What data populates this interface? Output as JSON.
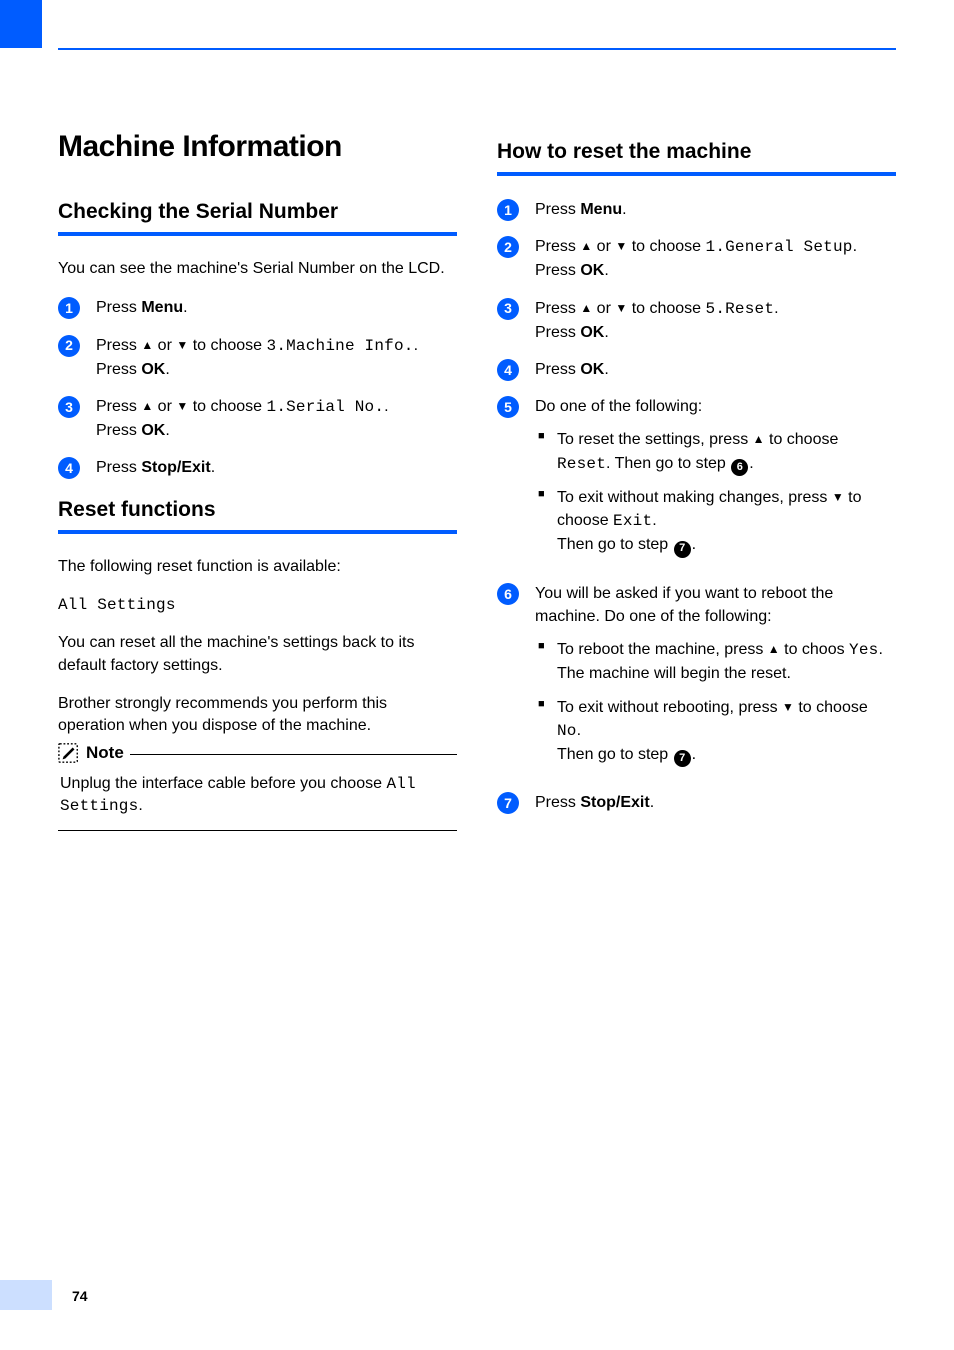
{
  "pageNumber": "74",
  "left": {
    "h1": "Machine Information",
    "h2a": "Checking the Serial Number",
    "intro": "You can see the machine's Serial Number on the LCD.",
    "steps_a": {
      "s1_press": "Press ",
      "s1_menu": "Menu",
      "s1_dot": ".",
      "s2_press": "Press ",
      "s2_up": "▲",
      "s2_or": " or ",
      "s2_down": "▼",
      "s2_tochoose": " to choose ",
      "s2_mono": "3.Machine Info.",
      "s2_dot": ".",
      "s2_press2": "Press ",
      "s2_ok": "OK",
      "s2_dot2": ".",
      "s3_press": "Press ",
      "s3_up": "▲",
      "s3_or": " or ",
      "s3_down": "▼",
      "s3_tochoose": " to choose ",
      "s3_mono": "1.Serial No.",
      "s3_dot": ".",
      "s3_press2": "Press ",
      "s3_ok": "OK",
      "s3_dot2": ".",
      "s4_press": "Press ",
      "s4_stop": "Stop/Exit",
      "s4_dot": "."
    },
    "h2b": "Reset functions",
    "reset_intro": "The following reset function is available:",
    "reset_mono": "All Settings",
    "reset_p1": "You can reset all the machine's settings back to its default factory settings.",
    "reset_p2": "Brother strongly recommends you perform this operation when you dispose of the machine.",
    "note_title": "Note",
    "note_body_a": "Unplug the interface cable before you choose ",
    "note_body_mono": "All Settings",
    "note_body_b": "."
  },
  "right": {
    "h2": "How to reset the machine",
    "s1_press": "Press ",
    "s1_menu": "Menu",
    "s1_dot": ".",
    "s2_press": "Press ",
    "s2_up": "▲",
    "s2_or": " or ",
    "s2_down": "▼",
    "s2_tochoose": " to choose ",
    "s2_mono": "1.General Setup",
    "s2_dot": ".",
    "s2_press2": "Press ",
    "s2_ok": "OK",
    "s2_dot2": ".",
    "s3_press": "Press ",
    "s3_up": "▲",
    "s3_or": " or ",
    "s3_down": "▼",
    "s3_tochoose": " to choose ",
    "s3_mono": "5.Reset",
    "s3_dot": ".",
    "s3_press2": "Press ",
    "s3_ok": "OK",
    "s3_dot2": ".",
    "s4_press": "Press ",
    "s4_ok": "OK",
    "s4_dot": ".",
    "s5_text": "Do one of the following:",
    "s5_b1a": "To reset the settings, press ",
    "s5_b1_up": "▲",
    "s5_b1b": " to choose ",
    "s5_b1_mono": "Reset",
    "s5_b1c": ". Then go to step ",
    "s5_b1_ref": "6",
    "s5_b1d": ".",
    "s5_b2a": "To exit without making changes, press ",
    "s5_b2_down": "▼",
    "s5_b2b": " to choose  ",
    "s5_b2_mono": "Exit",
    "s5_b2c": ".",
    "s5_b2d": "Then go to step ",
    "s5_b2_ref": "7",
    "s5_b2e": ".",
    "s6_text": "You will be asked if you want to reboot the machine. Do one of the following:",
    "s6_b1a": "To reboot the machine, press ",
    "s6_b1_up": "▲",
    "s6_b1b": " to choos ",
    "s6_b1_mono": "Yes",
    "s6_b1c": ".",
    "s6_b1d": "The machine will begin the reset.",
    "s6_b2a": "To exit without rebooting, press ",
    "s6_b2_down": "▼",
    "s6_b2b": " to choose ",
    "s6_b2_mono": "No",
    "s6_b2c": ".",
    "s6_b2d": "Then go to step ",
    "s6_b2_ref": "7",
    "s6_b2e": ".",
    "s7_press": "Press ",
    "s7_stop": "Stop/Exit",
    "s7_dot": "."
  }
}
